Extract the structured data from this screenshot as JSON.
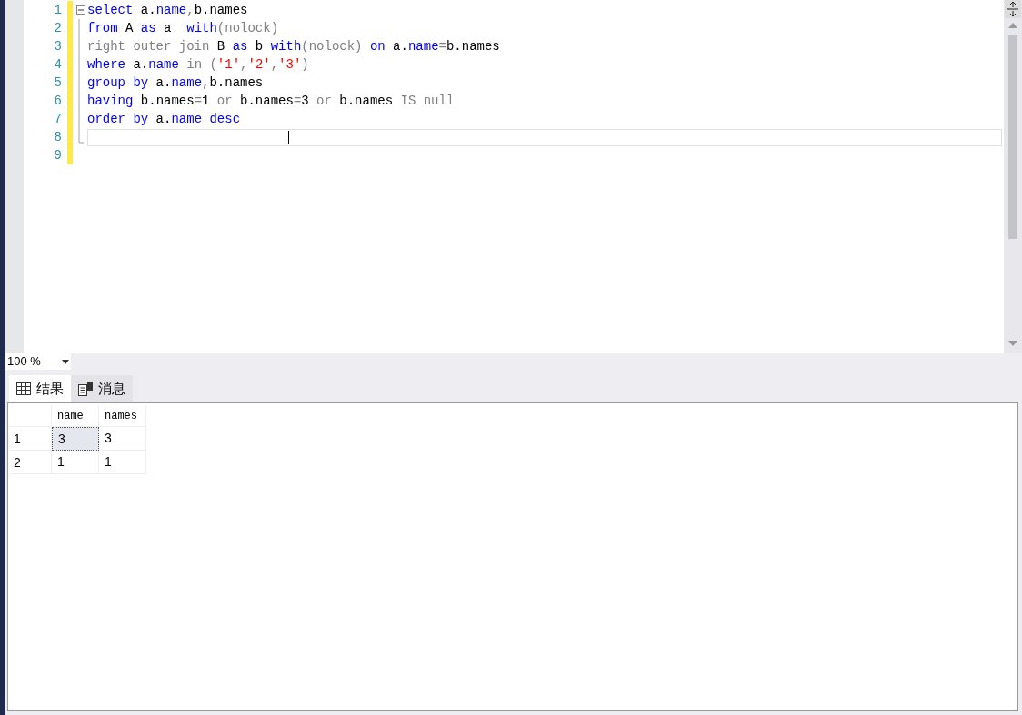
{
  "editor": {
    "lines": [
      {
        "number": "1",
        "fold": true,
        "current": false,
        "tokens": [
          {
            "text": "select",
            "kind": "k"
          },
          {
            "text": " a.",
            "kind": "t"
          },
          {
            "text": "name",
            "kind": "k"
          },
          {
            "text": ",",
            "kind": "g"
          },
          {
            "text": "b.names",
            "kind": "t"
          }
        ]
      },
      {
        "number": "2",
        "fold": false,
        "current": false,
        "tokens": [
          {
            "text": "from",
            "kind": "k"
          },
          {
            "text": " A ",
            "kind": "t"
          },
          {
            "text": "as",
            "kind": "k"
          },
          {
            "text": " a  ",
            "kind": "t"
          },
          {
            "text": "with",
            "kind": "k"
          },
          {
            "text": "(nolock)",
            "kind": "g"
          }
        ]
      },
      {
        "number": "3",
        "fold": false,
        "current": false,
        "tokens": [
          {
            "text": "right outer join",
            "kind": "g"
          },
          {
            "text": " B ",
            "kind": "t"
          },
          {
            "text": "as",
            "kind": "k"
          },
          {
            "text": " b ",
            "kind": "t"
          },
          {
            "text": "with",
            "kind": "k"
          },
          {
            "text": "(nolock) ",
            "kind": "g"
          },
          {
            "text": "on",
            "kind": "k"
          },
          {
            "text": " a.",
            "kind": "t"
          },
          {
            "text": "name",
            "kind": "k"
          },
          {
            "text": "=",
            "kind": "g"
          },
          {
            "text": "b.names",
            "kind": "t"
          }
        ]
      },
      {
        "number": "4",
        "fold": false,
        "current": false,
        "tokens": [
          {
            "text": "where",
            "kind": "k"
          },
          {
            "text": " a.",
            "kind": "t"
          },
          {
            "text": "name",
            "kind": "k"
          },
          {
            "text": " in (",
            "kind": "g"
          },
          {
            "text": "'1'",
            "kind": "s"
          },
          {
            "text": ",",
            "kind": "g"
          },
          {
            "text": "'2'",
            "kind": "s"
          },
          {
            "text": ",",
            "kind": "g"
          },
          {
            "text": "'3'",
            "kind": "s"
          },
          {
            "text": ")",
            "kind": "g"
          }
        ]
      },
      {
        "number": "5",
        "fold": false,
        "current": false,
        "tokens": [
          {
            "text": "group by",
            "kind": "k"
          },
          {
            "text": " a.",
            "kind": "t"
          },
          {
            "text": "name",
            "kind": "k"
          },
          {
            "text": ",",
            "kind": "g"
          },
          {
            "text": "b.names",
            "kind": "t"
          }
        ]
      },
      {
        "number": "6",
        "fold": false,
        "current": false,
        "tokens": [
          {
            "text": "having",
            "kind": "k"
          },
          {
            "text": " b.names",
            "kind": "t"
          },
          {
            "text": "=",
            "kind": "g"
          },
          {
            "text": "1",
            "kind": "t"
          },
          {
            "text": " or ",
            "kind": "g"
          },
          {
            "text": "b.names",
            "kind": "t"
          },
          {
            "text": "=",
            "kind": "g"
          },
          {
            "text": "3",
            "kind": "t"
          },
          {
            "text": " or ",
            "kind": "g"
          },
          {
            "text": "b.names ",
            "kind": "t"
          },
          {
            "text": "IS null",
            "kind": "g"
          }
        ]
      },
      {
        "number": "7",
        "fold": false,
        "current": false,
        "tokens": [
          {
            "text": "order by",
            "kind": "k"
          },
          {
            "text": " a.",
            "kind": "t"
          },
          {
            "text": "name",
            "kind": "k"
          },
          {
            "text": " desc",
            "kind": "k"
          }
        ]
      },
      {
        "number": "8",
        "fold": false,
        "current": true
      },
      {
        "number": "9",
        "fold": false,
        "current": false
      }
    ]
  },
  "zoom": "100 %",
  "tabs": [
    {
      "label": "结果",
      "kind": "grid",
      "selected": true
    },
    {
      "label": "消息",
      "kind": "messages",
      "selected": false
    }
  ],
  "grid": {
    "columns": [
      "name",
      "names"
    ],
    "rows": [
      {
        "number": "1",
        "cells": [
          {
            "text": "3",
            "selected": true
          },
          {
            "text": "3",
            "selected": false
          }
        ]
      },
      {
        "number": "2",
        "cells": [
          {
            "text": "1",
            "selected": false
          },
          {
            "text": "1",
            "selected": false
          }
        ]
      }
    ]
  }
}
